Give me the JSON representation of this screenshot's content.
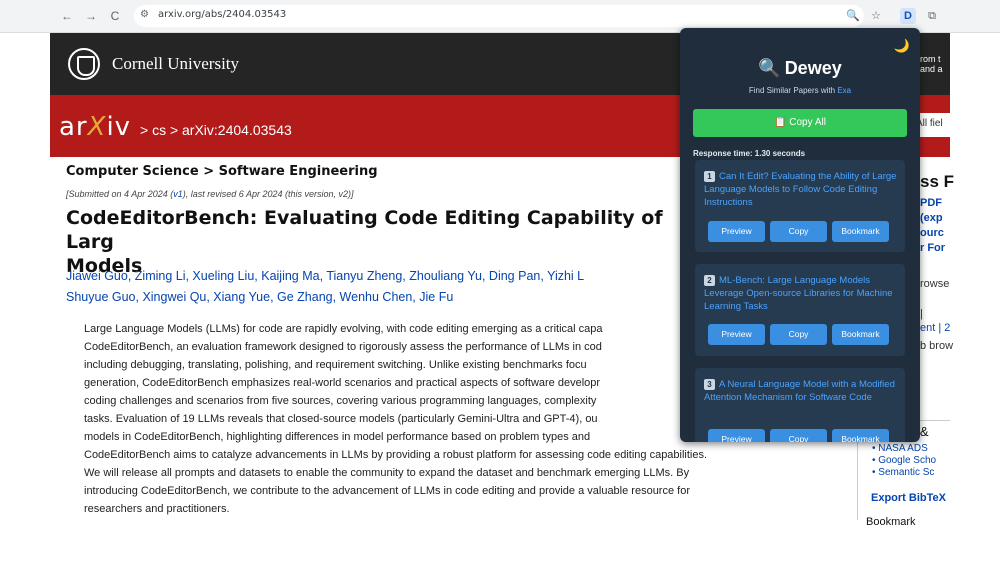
{
  "browser": {
    "back_icon": "←",
    "forward_icon": "→",
    "reload_icon": "C",
    "site_icon": "⚙",
    "url": "arxiv.org/abs/2404.03543",
    "zoom_icon": "🔍",
    "star_icon": "☆",
    "ext_icon": "D",
    "puzzle_icon": "⧉"
  },
  "header": {
    "institution": "Cornell University",
    "right_text_1": "rom t",
    "right_text_2": "and a"
  },
  "arxiv": {
    "logo_pre": "ar",
    "logo_x": "X",
    "logo_post": "iv",
    "breadcrumb": "> cs > arXiv:2404.03543",
    "search_label": "All fiel"
  },
  "paper": {
    "subject": "Computer Science > Software Engineering",
    "submitted_pre": "[Submitted on 4 Apr 2024 (",
    "submitted_v1": "v1",
    "submitted_post": "), last revised 6 Apr 2024 (this version, v2)]",
    "title_line1": "CodeEditorBench: Evaluating Code Editing Capability of Larg",
    "title_line2": "Models",
    "authors_line1": "Jiawei Guo, Ziming Li, Xueling Liu, Kaijing Ma, Tianyu Zheng, Zhouliang Yu, Ding Pan, Yizhi L",
    "authors_line2": "Shuyue Guo, Xingwei Qu, Xiang Yue, Ge Zhang, Wenhu Chen, Jie Fu",
    "abstract_lines": [
      "Large Language Models (LLMs) for code are rapidly evolving, with code editing emerging as a critical capa",
      "CodeEditorBench, an evaluation framework designed to rigorously assess the performance of LLMs in cod",
      "including debugging, translating, polishing, and requirement switching. Unlike existing benchmarks focu",
      "generation, CodeEditorBench emphasizes real-world scenarios and practical aspects of software developr",
      "coding challenges and scenarios from five sources, covering various programming languages, complexity",
      "tasks. Evaluation of 19 LLMs reveals that closed-source models (particularly Gemini-Ultra and GPT-4), ou",
      "models in CodeEditorBench, highlighting differences in model performance based on problem types and",
      "CodeEditorBench aims to catalyze advancements in LLMs by providing a robust platform for assessing code editing capabilities.",
      "We will release all prompts and datasets to enable the community to expand the dataset and benchmark emerging LLMs. By",
      "introducing CodeEditorBench, we contribute to the advancement of LLMs in code editing and provide a valuable resource for",
      "researchers and practitioners."
    ]
  },
  "sidebar": {
    "heading": "ss F",
    "links": [
      "PDF",
      "(exp",
      "ourc",
      "r For"
    ],
    "browse_text": "rowse",
    "pipe_text": "|",
    "nav_text": "ent | 2",
    "brow_text": "b brow",
    "refs_head": "ces &",
    "refs_items": [
      "• NASA ADS",
      "• Google Scho",
      "• Semantic Sc"
    ],
    "bibtex": "Export BibTeX",
    "bookmark": "Bookmark"
  },
  "dewey": {
    "moon_icon": "🌙",
    "search_icon": "🔍",
    "title": "Dewey",
    "tagline_pre": "Find Similar Papers with ",
    "tagline_link": "Exa",
    "copy_all": "📋 Copy All",
    "response_time": "Response time: 1.30 seconds",
    "results": [
      {
        "num": "1",
        "title": "Can It Edit? Evaluating the Ability of Large Language Models to Follow Code Editing Instructions"
      },
      {
        "num": "2",
        "title": "ML-Bench: Large Language Models Leverage Open-source Libraries for Machine Learning Tasks"
      },
      {
        "num": "3",
        "title": "A Neural Language Model with a Modified Attention Mechanism for Software Code"
      }
    ],
    "btn_preview": "Preview",
    "btn_copy": "Copy",
    "btn_bookmark": "Bookmark"
  }
}
